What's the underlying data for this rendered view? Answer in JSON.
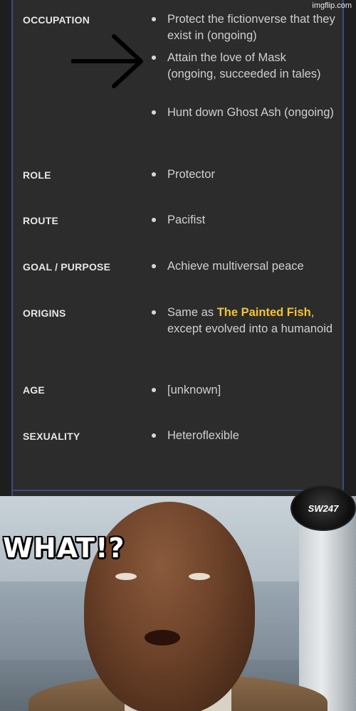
{
  "watermark": "imgflip.com",
  "rows": [
    {
      "label": "OCCUPATION",
      "values": [
        "Protect the fictionverse that they exist in (ongoing)",
        "Attain the love of Mask (ongoing, succeeded in tales)",
        "Hunt down Ghost Ash (ongoing)"
      ]
    },
    {
      "label": "ROLE",
      "values": [
        "Protector"
      ]
    },
    {
      "label": "ROUTE",
      "values": [
        "Pacifist"
      ]
    },
    {
      "label": "GOAL / PURPOSE",
      "values": [
        "Achieve multiversal peace"
      ]
    },
    {
      "label": "ORIGINS",
      "values_prefix": "Same as ",
      "values_link": "The Painted Fish",
      "values_suffix": ", except evolved into a humanoid"
    },
    {
      "label": "AGE",
      "values": [
        "[unknown]"
      ]
    },
    {
      "label": "SEXUALITY",
      "values": [
        "Heteroflexible"
      ]
    }
  ],
  "meme": {
    "caption": "WHAT!?",
    "logo": "SW247"
  },
  "colors": {
    "link": "#f4c430",
    "panel_border": "#3b4b82"
  }
}
